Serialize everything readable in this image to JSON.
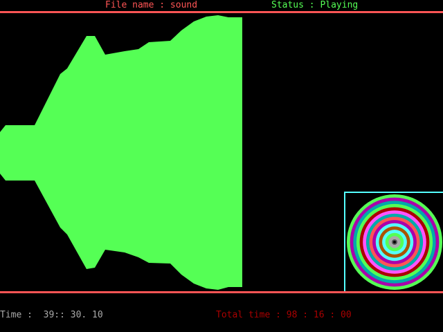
{
  "header": {
    "file_name": "File name : sound",
    "status": "Status : Playing"
  },
  "footer": {
    "time": "Time :  39:: 30. 10",
    "total_time": "Total time : 98 : 16 : 00"
  },
  "colors": {
    "header_file_name": "#ff5555",
    "header_status": "#55ff55",
    "divider_lines": "#ff5555",
    "waveform_fill": "#55ff55",
    "disc_frame": "#55ffff",
    "time_text": "#aaaaaa",
    "total_time_text": "#aa0000",
    "disc_ring_colors": [
      "#55ff55",
      "#aa00aa",
      "#00aaaa",
      "#55ff55",
      "#aa0000",
      "#ff55ff",
      "#00aaaa",
      "#ff5555",
      "#aa00aa",
      "#55ffff",
      "#aa5500",
      "#55ffff",
      "#55ff55",
      "#aaaaaa",
      "#555555"
    ]
  },
  "icons": {
    "visualizer": "speaker-cone-waveform-icon",
    "disc": "spinning-disc-icon"
  }
}
